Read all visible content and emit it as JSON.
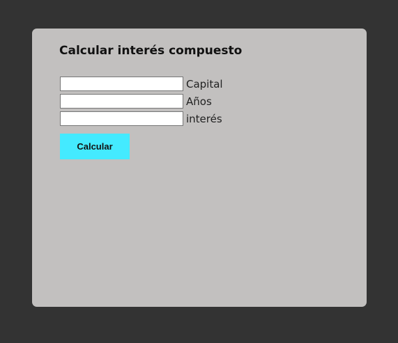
{
  "form": {
    "title": "Calcular interés compuesto",
    "fields": [
      {
        "label": "Capital",
        "value": "",
        "placeholder": ""
      },
      {
        "label": "Años",
        "value": "",
        "placeholder": ""
      },
      {
        "label": "interés",
        "value": "",
        "placeholder": ""
      }
    ],
    "submit_label": "Calcular"
  },
  "colors": {
    "page_background": "#333333",
    "card_background": "#c2c0bf",
    "button_background": "#44eaff"
  }
}
